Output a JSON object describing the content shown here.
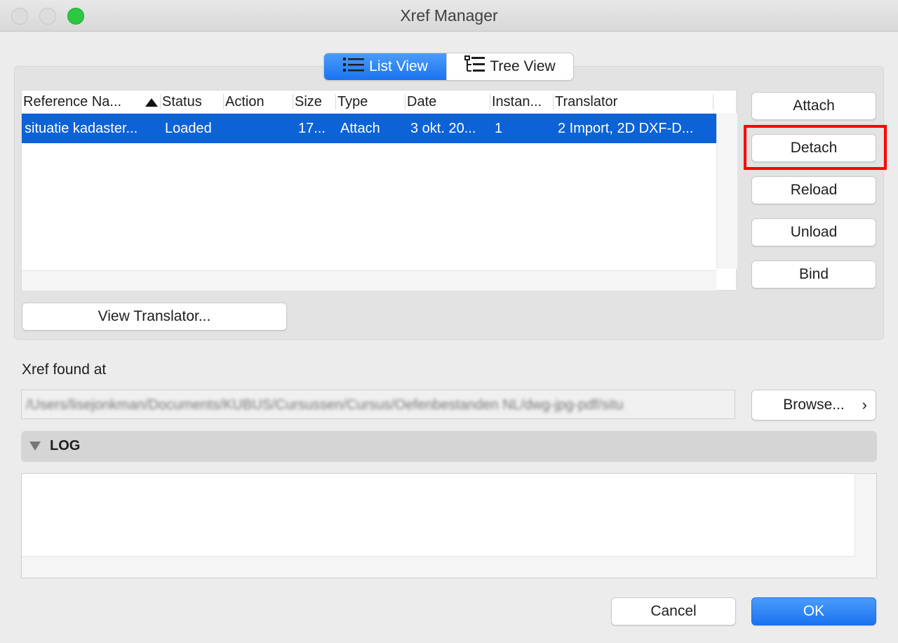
{
  "window": {
    "title": "Xref Manager"
  },
  "view_toggle": {
    "list_label": "List View",
    "tree_label": "Tree View",
    "selected": "List View"
  },
  "table": {
    "columns": [
      "Reference Na...",
      "Status",
      "Action",
      "Size",
      "Type",
      "Date",
      "Instan...",
      "Translator"
    ],
    "sorted_column": "Reference Na...",
    "rows": [
      {
        "reference_name": "situatie kadaster...",
        "status": "Loaded",
        "action": "",
        "size": "17...",
        "type": "Attach",
        "date": "3 okt. 20...",
        "instances": "1",
        "translator": "2 Import, 2D DXF-D..."
      }
    ]
  },
  "side_buttons": {
    "attach": "Attach",
    "detach": "Detach",
    "reload": "Reload",
    "unload": "Unload",
    "bind": "Bind"
  },
  "view_translator_label": "View Translator...",
  "found_at": {
    "label": "Xref found at",
    "path": "/Users/lisejonkman/Documents/KUBUS/Cursussen/Cursus/Oefenbestanden NL/dwg-jpg-pdf/situ",
    "browse_label": "Browse...",
    "browse_chevron": "›"
  },
  "log": {
    "label": "LOG"
  },
  "footer": {
    "cancel": "Cancel",
    "ok": "OK"
  },
  "colors": {
    "accent": "#1a73f0",
    "selection": "#0c62d6",
    "highlight": "#ff0000"
  }
}
